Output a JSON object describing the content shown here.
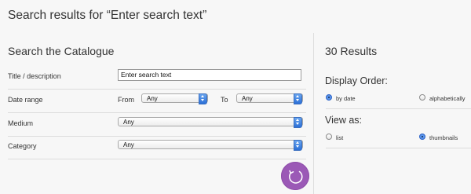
{
  "header": {
    "title": "Search results for “Enter search text”"
  },
  "search": {
    "panel_title": "Search the Catalogue",
    "title_label": "Title / description",
    "title_value": "Enter search text",
    "date_label": "Date range",
    "from_label": "From",
    "from_value": "Any",
    "to_label": "To",
    "to_value": "Any",
    "medium_label": "Medium",
    "medium_value": "Any",
    "category_label": "Category",
    "category_value": "Any"
  },
  "results": {
    "count_text": "30 Results",
    "display_order_heading": "Display Order:",
    "order_options": [
      {
        "label": "by date",
        "selected": true
      },
      {
        "label": "alphabetically",
        "selected": false
      }
    ],
    "view_heading": "View as:",
    "view_options": [
      {
        "label": "list",
        "selected": false
      },
      {
        "label": "thumbnails",
        "selected": true
      }
    ]
  },
  "icons": {
    "submit": "refresh-arrow-icon"
  },
  "colors": {
    "accent": "#9b59b6",
    "radio_selected": "#5b95ea",
    "panel_background": "#f7f7f7",
    "select_arrow": "#2b6fd6"
  }
}
